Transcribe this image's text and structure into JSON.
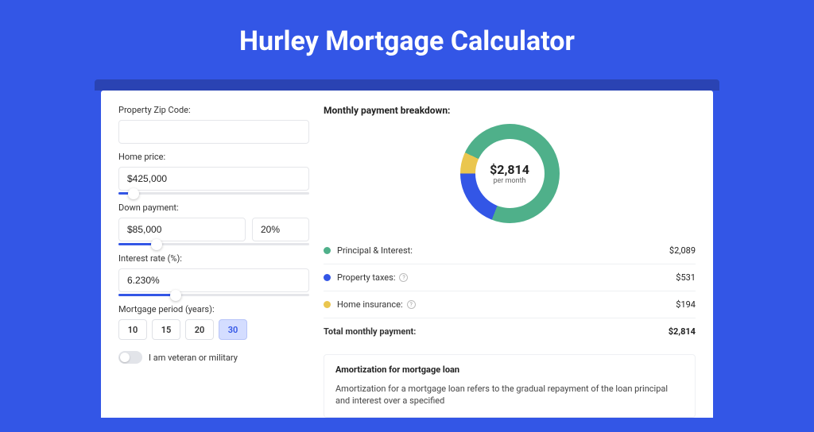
{
  "page_title": "Hurley Mortgage Calculator",
  "form": {
    "zip_label": "Property Zip Code:",
    "zip_value": "",
    "home_price_label": "Home price:",
    "home_price_value": "$425,000",
    "home_price_slider_pct": 8,
    "down_payment_label": "Down payment:",
    "down_payment_value": "$85,000",
    "down_payment_pct": "20%",
    "down_payment_slider_pct": 20,
    "interest_label": "Interest rate (%):",
    "interest_value": "6.230%",
    "interest_slider_pct": 30,
    "period_label": "Mortgage period (years):",
    "period_options": [
      "10",
      "15",
      "20",
      "30"
    ],
    "period_active_index": 3,
    "veteran_label": "I am veteran or military"
  },
  "breakdown": {
    "title": "Monthly payment breakdown:",
    "donut_amount": "$2,814",
    "donut_sub": "per month",
    "items": [
      {
        "label": "Principal & Interest:",
        "value": "$2,089",
        "color": "#4fb08a",
        "pct": 74,
        "info": false
      },
      {
        "label": "Property taxes:",
        "value": "$531",
        "color": "#3356e6",
        "pct": 19,
        "info": true
      },
      {
        "label": "Home insurance:",
        "value": "$194",
        "color": "#eac64f",
        "pct": 7,
        "info": true
      }
    ],
    "total_label": "Total monthly payment:",
    "total_value": "$2,814"
  },
  "amort": {
    "title": "Amortization for mortgage loan",
    "text": "Amortization for a mortgage loan refers to the gradual repayment of the loan principal and interest over a specified"
  },
  "chart_data": {
    "type": "pie",
    "title": "Monthly payment breakdown",
    "series": [
      {
        "name": "Principal & Interest",
        "value": 2089,
        "color": "#4fb08a"
      },
      {
        "name": "Property taxes",
        "value": 531,
        "color": "#3356e6"
      },
      {
        "name": "Home insurance",
        "value": 194,
        "color": "#eac64f"
      }
    ],
    "total": 2814,
    "center_label": "$2,814 per month"
  }
}
